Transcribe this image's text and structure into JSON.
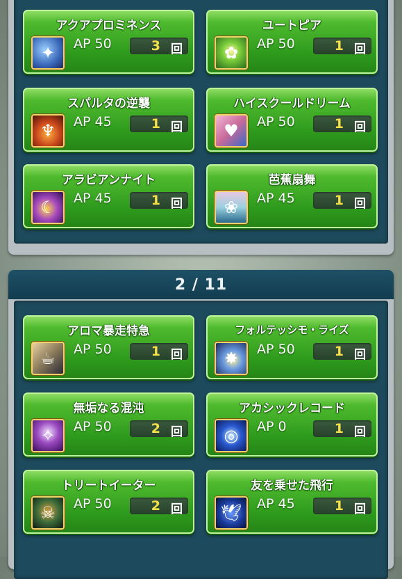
{
  "upper_section": {
    "items": [
      {
        "title": "アクアプロミネンス",
        "ap": "AP 50",
        "count": "3",
        "unit": "回",
        "icon": "water-swirl-icon",
        "icon_color": "#3a66b8"
      },
      {
        "title": "ユートピア",
        "ap": "AP 50",
        "count": "1",
        "unit": "回",
        "icon": "flower-light-icon",
        "icon_color": "#3f8a2e"
      },
      {
        "title": "スパルタの逆襲",
        "ap": "AP 45",
        "count": "1",
        "unit": "回",
        "icon": "fire-battle-icon",
        "icon_color": "#b8461c"
      },
      {
        "title": "ハイスクールドリーム",
        "ap": "AP 50",
        "count": "1",
        "unit": "回",
        "icon": "school-dream-icon",
        "icon_color": "#c86a9a"
      },
      {
        "title": "アラビアンナイト",
        "ap": "AP 45",
        "count": "1",
        "unit": "回",
        "icon": "lamp-night-icon",
        "icon_color": "#7a2ea8"
      },
      {
        "title": "芭蕉扇舞",
        "ap": "AP 45",
        "count": "1",
        "unit": "回",
        "icon": "fan-dance-icon",
        "icon_color": "#4a9ab0"
      }
    ]
  },
  "lower_section": {
    "page_indicator": "2 / 11",
    "items": [
      {
        "title": "アロマ暴走特急",
        "ap": "AP 50",
        "count": "1",
        "unit": "回",
        "icon": "aroma-express-icon",
        "icon_color": "#8a7a5a"
      },
      {
        "title": "フォルテッシモ・ライズ",
        "ap": "AP 50",
        "count": "1",
        "unit": "回",
        "icon": "fortissimo-rise-icon",
        "icon_color": "#3a5aa0"
      },
      {
        "title": "無垢なる混沌",
        "ap": "AP 50",
        "count": "2",
        "unit": "回",
        "icon": "innocent-chaos-icon",
        "icon_color": "#9a4ac0"
      },
      {
        "title": "アカシックレコード",
        "ap": "AP 0",
        "count": "1",
        "unit": "回",
        "icon": "akashic-record-icon",
        "icon_color": "#2a5ad0"
      },
      {
        "title": "トリートイーター",
        "ap": "AP 50",
        "count": "2",
        "unit": "回",
        "icon": "treat-eater-icon",
        "icon_color": "#3a6a3a"
      },
      {
        "title": "友を乗せた飛行",
        "ap": "AP 45",
        "count": "1",
        "unit": "回",
        "icon": "dove-flight-icon",
        "icon_color": "#1a3a9a"
      }
    ]
  },
  "colors": {
    "card_green": "#2e9a1d",
    "count_yellow": "#f6e04a",
    "panel_navy": "#1d4a5c"
  }
}
